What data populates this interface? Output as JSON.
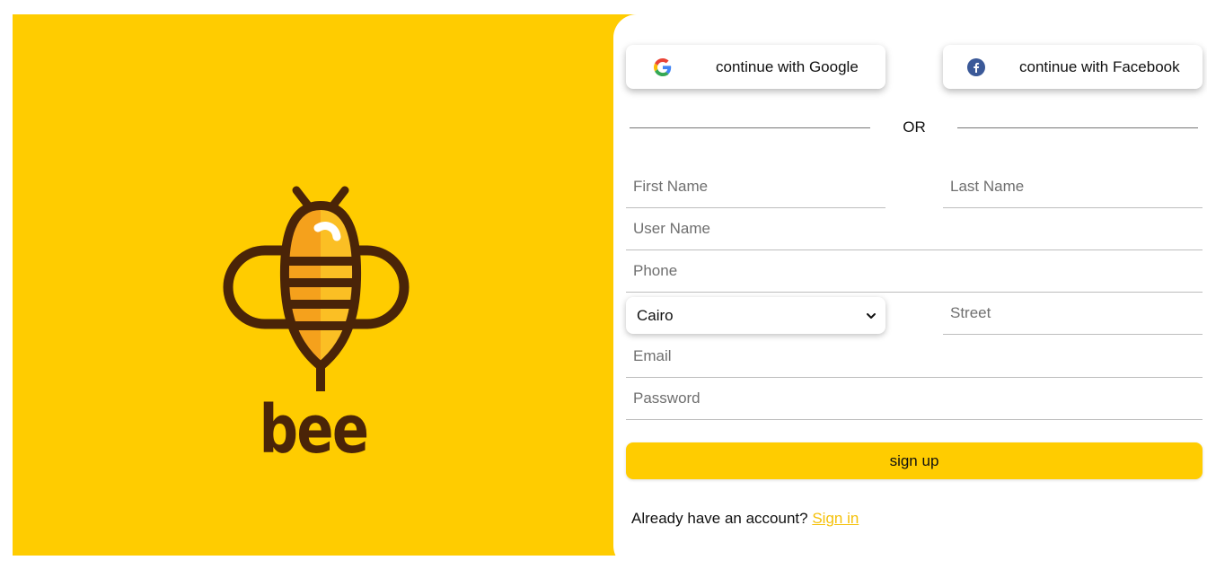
{
  "brand": {
    "logo_text": "bee",
    "accent_color": "#ffcc00",
    "logo_dark_color": "#4a2408",
    "logo_orange_color": "#f5a11c"
  },
  "social": {
    "google": {
      "label": "continue with Google",
      "icon": "google-icon"
    },
    "facebook": {
      "label": "continue with Facebook",
      "icon": "facebook-icon"
    }
  },
  "divider": {
    "text": "OR"
  },
  "form": {
    "first_name": {
      "placeholder": "First Name",
      "value": ""
    },
    "last_name": {
      "placeholder": "Last Name",
      "value": ""
    },
    "user_name": {
      "placeholder": "User Name",
      "value": ""
    },
    "phone": {
      "placeholder": "Phone",
      "value": ""
    },
    "city": {
      "selected": "Cairo",
      "icon": "chevron-down-icon"
    },
    "street": {
      "placeholder": "Street",
      "value": ""
    },
    "email": {
      "placeholder": "Email",
      "value": ""
    },
    "password": {
      "placeholder": "Password",
      "value": ""
    }
  },
  "actions": {
    "signup_label": "sign up",
    "signin_prompt": "Already have an account?",
    "signin_link": "Sign in"
  }
}
